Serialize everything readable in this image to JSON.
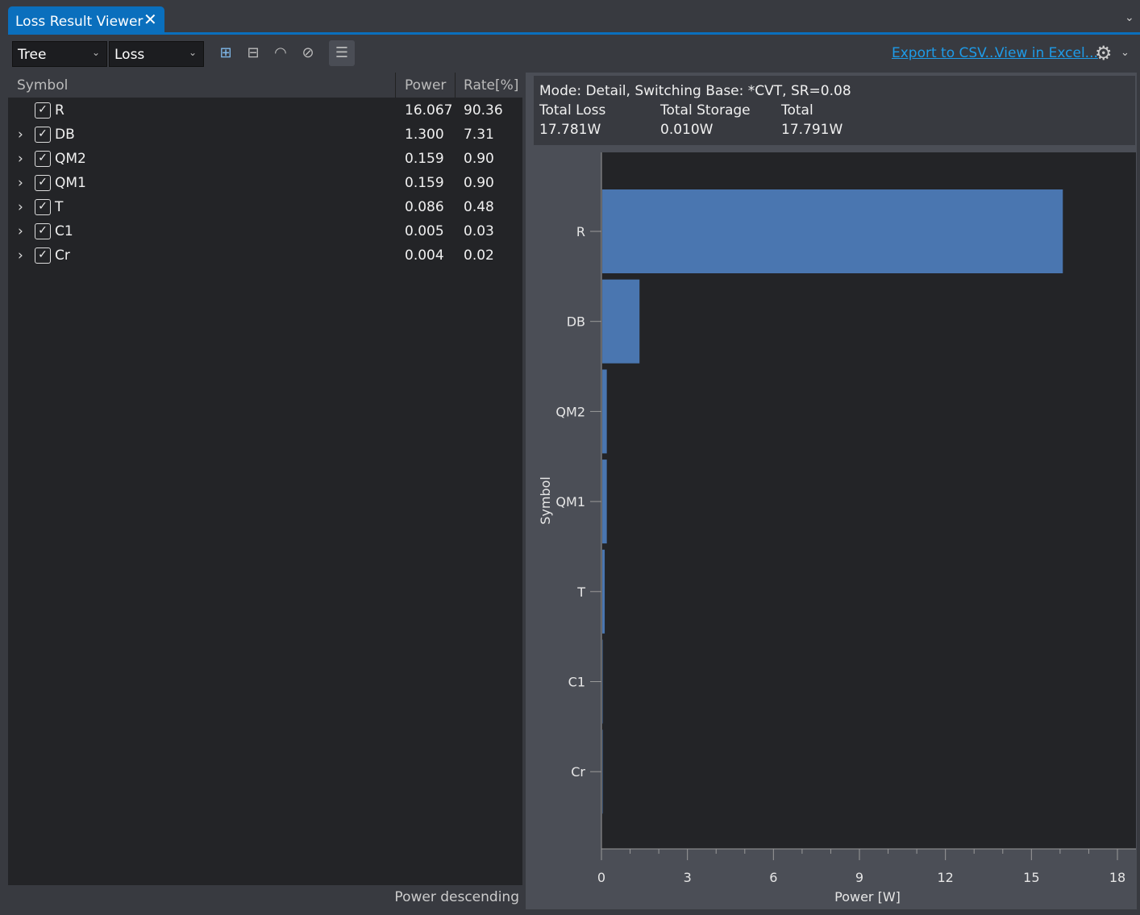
{
  "tab": {
    "title": "Loss Result Viewer"
  },
  "toolbar": {
    "view_select": "Tree",
    "type_select": "Loss",
    "icons": [
      "expand-all-icon",
      "collapse-all-icon",
      "show-icon",
      "hide-icon",
      "fit-columns-icon"
    ],
    "export_csv": "Export to CSV...",
    "view_excel": "View in Excel..."
  },
  "table": {
    "headers": {
      "symbol": "Symbol",
      "power": "Power",
      "rate": "Rate[%]"
    },
    "rows": [
      {
        "symbol": "R",
        "power": "16.067",
        "rate": "90.36",
        "checked": true,
        "expandable": false
      },
      {
        "symbol": "DB",
        "power": "1.300",
        "rate": "7.31",
        "checked": true,
        "expandable": true
      },
      {
        "symbol": "QM2",
        "power": "0.159",
        "rate": "0.90",
        "checked": true,
        "expandable": true
      },
      {
        "symbol": "QM1",
        "power": "0.159",
        "rate": "0.90",
        "checked": true,
        "expandable": true
      },
      {
        "symbol": "T",
        "power": "0.086",
        "rate": "0.48",
        "checked": true,
        "expandable": true
      },
      {
        "symbol": "C1",
        "power": "0.005",
        "rate": "0.03",
        "checked": true,
        "expandable": true
      },
      {
        "symbol": "Cr",
        "power": "0.004",
        "rate": "0.02",
        "checked": true,
        "expandable": true
      }
    ],
    "status": "Power descending"
  },
  "info": {
    "mode": "Mode: Detail, Switching Base: *CVT, SR=0.08",
    "total_loss_label": "Total Loss",
    "total_loss": "17.781W",
    "total_storage_label": "Total Storage",
    "total_storage": "0.010W",
    "total_label": "Total",
    "total": "17.791W"
  },
  "colors": {
    "accent": "#0a6fbd",
    "bar": "#4a76b0",
    "link": "#1e9be8"
  },
  "chart_data": {
    "type": "bar",
    "orientation": "horizontal",
    "categories": [
      "R",
      "DB",
      "QM2",
      "QM1",
      "T",
      "C1",
      "Cr"
    ],
    "values": [
      16.067,
      1.3,
      0.159,
      0.159,
      0.086,
      0.005,
      0.004
    ],
    "xlabel": "Power [W]",
    "ylabel": "Symbol",
    "xlim": [
      0,
      18
    ],
    "xticks": [
      "0",
      "3",
      "6",
      "9",
      "12",
      "15",
      "18"
    ],
    "grid": false
  }
}
